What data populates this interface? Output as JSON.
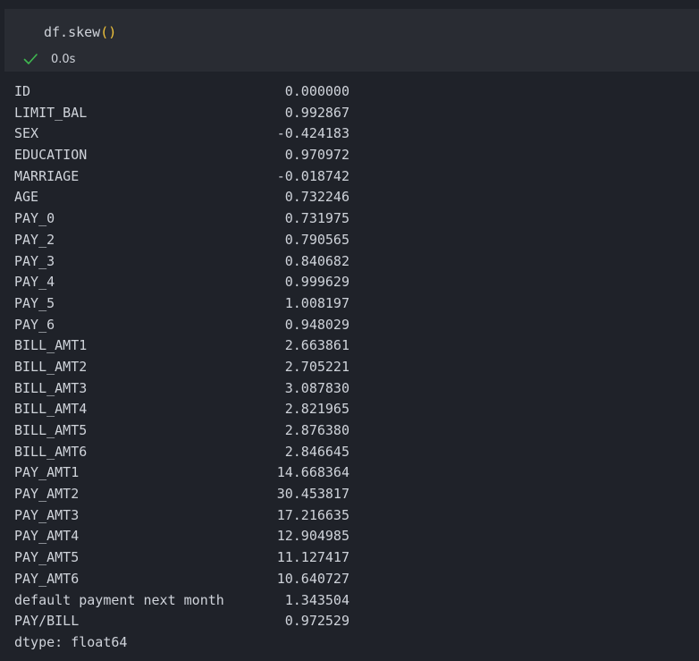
{
  "cell": {
    "code_prefix": "df.skew",
    "code_parens": "()",
    "exec_time": "0.0s",
    "status_icon": "check-icon"
  },
  "output": {
    "rows": [
      {
        "name": "ID",
        "value": "0.000000"
      },
      {
        "name": "LIMIT_BAL",
        "value": "0.992867"
      },
      {
        "name": "SEX",
        "value": "-0.424183"
      },
      {
        "name": "EDUCATION",
        "value": "0.970972"
      },
      {
        "name": "MARRIAGE",
        "value": "-0.018742"
      },
      {
        "name": "AGE",
        "value": "0.732246"
      },
      {
        "name": "PAY_0",
        "value": "0.731975"
      },
      {
        "name": "PAY_2",
        "value": "0.790565"
      },
      {
        "name": "PAY_3",
        "value": "0.840682"
      },
      {
        "name": "PAY_4",
        "value": "0.999629"
      },
      {
        "name": "PAY_5",
        "value": "1.008197"
      },
      {
        "name": "PAY_6",
        "value": "0.948029"
      },
      {
        "name": "BILL_AMT1",
        "value": "2.663861"
      },
      {
        "name": "BILL_AMT2",
        "value": "2.705221"
      },
      {
        "name": "BILL_AMT3",
        "value": "3.087830"
      },
      {
        "name": "BILL_AMT4",
        "value": "2.821965"
      },
      {
        "name": "BILL_AMT5",
        "value": "2.876380"
      },
      {
        "name": "BILL_AMT6",
        "value": "2.846645"
      },
      {
        "name": "PAY_AMT1",
        "value": "14.668364"
      },
      {
        "name": "PAY_AMT2",
        "value": "30.453817"
      },
      {
        "name": "PAY_AMT3",
        "value": "17.216635"
      },
      {
        "name": "PAY_AMT4",
        "value": "12.904985"
      },
      {
        "name": "PAY_AMT5",
        "value": "11.127417"
      },
      {
        "name": "PAY_AMT6",
        "value": "10.640727"
      },
      {
        "name": "default payment next month",
        "value": "1.343504"
      },
      {
        "name": "PAY/BILL",
        "value": "0.972529"
      }
    ],
    "dtype_line": "dtype: float64"
  },
  "colors": {
    "background": "#1f2229",
    "cell_background": "#292c33",
    "text": "#cfd3da",
    "paren": "#f2c43b",
    "success": "#3fb950"
  }
}
